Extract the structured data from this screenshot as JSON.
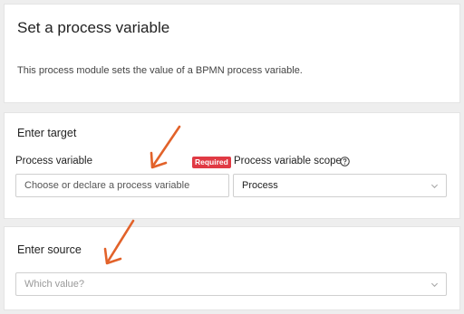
{
  "header": {
    "title": "Set a process variable",
    "description": "This process module sets the value of a BPMN process variable."
  },
  "target": {
    "title": "Enter target",
    "process_variable_label": "Process variable",
    "required_badge": "Required",
    "process_variable_placeholder": "Choose or declare a process variable",
    "scope_label": "Process variable scope",
    "scope_help_icon": "question-circle-icon",
    "scope_value": "Process"
  },
  "source": {
    "title": "Enter source",
    "value_placeholder": "Which value?"
  },
  "annotations": {
    "arrow_color": "#e2622a"
  },
  "colors": {
    "required_badge": "#e03a44",
    "background": "#eeeeee"
  }
}
